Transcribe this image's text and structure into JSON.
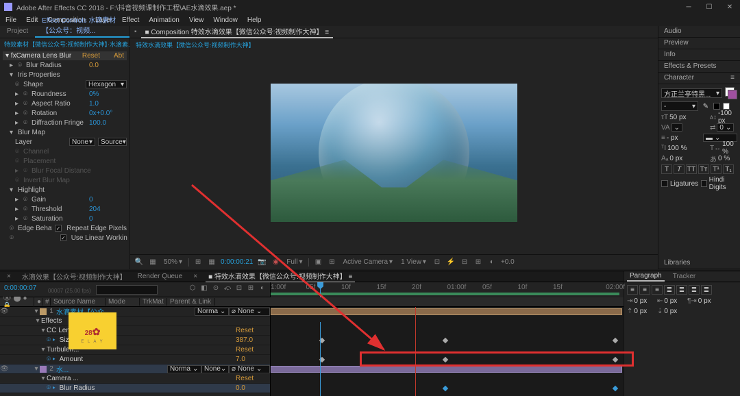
{
  "titlebar": {
    "title": "Adobe After Effects CC 2018 - F:\\抖音视频课制作工程\\AE水滴效果.aep *"
  },
  "menu": [
    "File",
    "Edit",
    "Composition",
    "Layer",
    "Effect",
    "Animation",
    "View",
    "Window",
    "Help"
  ],
  "left_panel": {
    "tab_project": "Project",
    "tab_ec": "Effect Controls 水滴素材【公众号：视频...",
    "subtab": "特效素材【微信公众号:视频制作大神】·水滴素...",
    "effect_name": "Camera Lens Blur",
    "reset": "Reset",
    "about": "Abt",
    "props": {
      "blur_radius": {
        "label": "Blur Radius",
        "value": "0.0"
      },
      "iris_props": "Iris Properties",
      "shape": {
        "label": "Shape",
        "value": "Hexagon"
      },
      "roundness": {
        "label": "Roundness",
        "value": "0%"
      },
      "aspect": {
        "label": "Aspect Ratio",
        "value": "1.0"
      },
      "rotation": {
        "label": "Rotation",
        "value": "0x+0.0°"
      },
      "diffraction": {
        "label": "Diffraction Fringe",
        "value": "100.0"
      },
      "blur_map": "Blur Map",
      "layer": {
        "label": "Layer",
        "value": "None",
        "source": "Source"
      },
      "channel": "Channel",
      "placement": "Placement",
      "blur_focal": "Blur Focal Distance",
      "invert": "Invert Blur Map",
      "highlight": "Highlight",
      "gain": {
        "label": "Gain",
        "value": "0"
      },
      "threshold": {
        "label": "Threshold",
        "value": "204"
      },
      "saturation": {
        "label": "Saturation",
        "value": "0"
      },
      "edge": "Edge Behavior",
      "repeat_edge": "Repeat Edge Pixels",
      "linear": "Use Linear Workin"
    }
  },
  "comp": {
    "tab_prefix": "Composition",
    "tab_name": "特效水滴效果【微信公众号:视频制作大神】",
    "crumb": "特效水滴效果【微信公众号:视频制作大神】"
  },
  "viewer_bar": {
    "zoom": "50%",
    "time": "0:00:00:21",
    "quality": "Full",
    "camera": "Active Camera",
    "views": "1 View",
    "exposure": "+0.0"
  },
  "right_tabs": {
    "audio": "Audio",
    "preview": "Preview",
    "info": "Info",
    "effects_presets": "Effects & Presets",
    "character": "Character",
    "libraries": "Libraries"
  },
  "character": {
    "font": "方正兰亭特黑...",
    "size": "50 px",
    "leading": "-100 px",
    "va": "VA",
    "vaval": "0",
    "tracking": "-",
    "stroke": "- px",
    "fill": "100 %",
    "scale1": "100 %",
    "scale2": "100 %",
    "baseline": "0 px",
    "tsume": "0 %",
    "ligatures": "Ligatures",
    "hindi": "Hindi Digits"
  },
  "timeline": {
    "tab1": "水滴效果【公众号:视频制作大神】",
    "tab_rq": "Render Queue",
    "tab3": "特效水滴效果【微信公众号:视频制作大神】",
    "time": "0:00:00:07",
    "time_sub": "00007 (25.00 fps)",
    "cols": {
      "source": "Source Name",
      "mode": "Mode",
      "trkmat": "TrkMat",
      "parent": "Parent & Link"
    },
    "ticks": [
      "1:00f",
      "05f",
      "10f",
      "15f",
      "20f",
      "01:00f",
      "05f",
      "10f",
      "15f",
      "02:00f"
    ],
    "layers": {
      "l1_name": "水滴素材【公众...",
      "l1_mode": "Norma",
      "l1_parent": "None",
      "effects": "Effects",
      "cclens": "CC Lens",
      "cclens_reset": "Reset",
      "cclens_size": "Size",
      "cclens_size_v": "387.0",
      "turbulent": "Turbulen...",
      "turb_reset": "Reset",
      "turb_amt": "Amount",
      "turb_amt_v": "7.0",
      "l2_name": "水...",
      "l2_mode": "Norma",
      "l2_parent": "None",
      "camera_lens": "Camera ...",
      "cl_reset": "Reset",
      "blur_radius": "Blur Radius",
      "blur_radius_v": "0.0"
    }
  },
  "paragraph": {
    "tab_para": "Paragraph",
    "tab_tracker": "Tracker",
    "indent1": "0 px",
    "indent2": "0 px",
    "indent3": "0 px",
    "space1": "0 px",
    "space2": "0 px"
  },
  "watermark": {
    "num": "28",
    "sub": "E  L  A  Y"
  }
}
